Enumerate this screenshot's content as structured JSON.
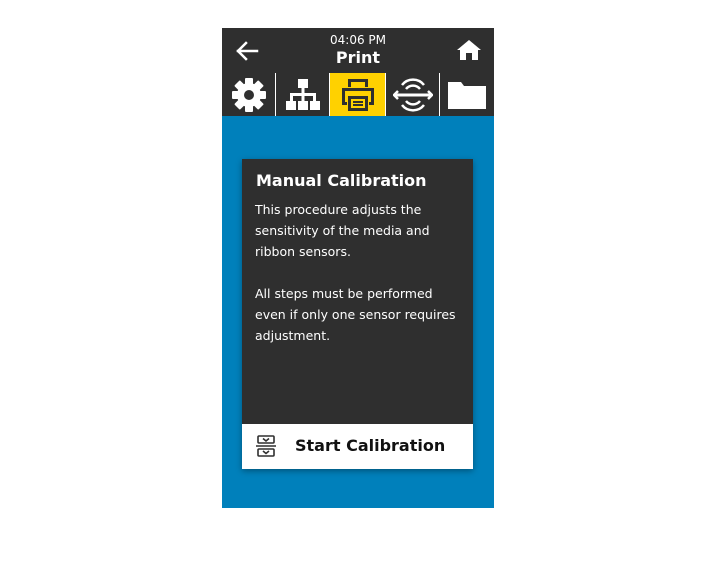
{
  "header": {
    "time": "04:06 PM",
    "title": "Print",
    "back_icon": "arrow-left-icon",
    "home_icon": "home-icon"
  },
  "tabs": [
    {
      "icon": "gear-icon",
      "active": false
    },
    {
      "icon": "network-icon",
      "active": false
    },
    {
      "icon": "printer-icon",
      "active": true
    },
    {
      "icon": "wireless-signal-icon",
      "active": false
    },
    {
      "icon": "folder-icon",
      "active": false
    }
  ],
  "dialog": {
    "title": "Manual Calibration",
    "paragraph1": "This procedure adjusts the sensitivity of the media and ribbon sensors.",
    "paragraph2": "All steps must be performed even if only one sensor requires adjustment.",
    "action_label": "Start Calibration",
    "action_icon": "calibration-icon"
  },
  "colors": {
    "background": "#0080bb",
    "header": "#2f2f2f",
    "active_tab": "#ffd100",
    "card": "#2f2f2f"
  }
}
